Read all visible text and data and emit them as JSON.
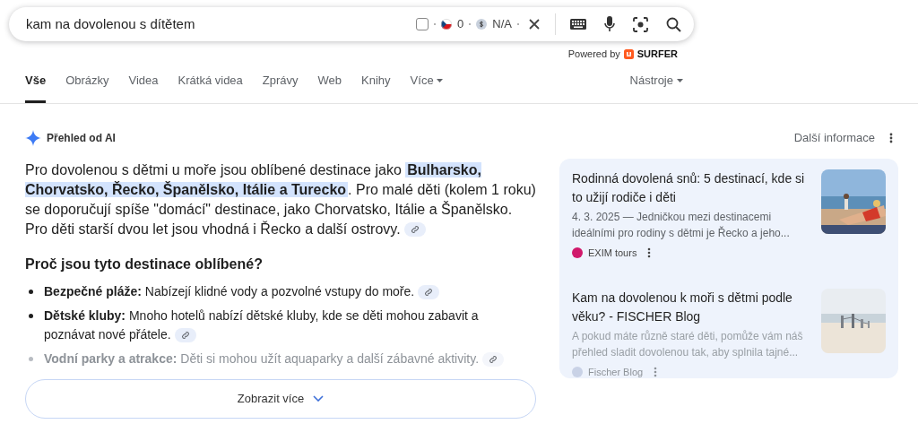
{
  "search": {
    "value": "kam na dovolenou s dítětem",
    "checked": false,
    "flag_count": "0",
    "price": "N/A",
    "powered_by": "Powered by",
    "brand": "SURFER"
  },
  "tabs": [
    {
      "label": "Vše",
      "selected": true,
      "dropdown": false
    },
    {
      "label": "Obrázky",
      "selected": false,
      "dropdown": false
    },
    {
      "label": "Videa",
      "selected": false,
      "dropdown": false
    },
    {
      "label": "Krátká videa",
      "selected": false,
      "dropdown": false
    },
    {
      "label": "Zprávy",
      "selected": false,
      "dropdown": false
    },
    {
      "label": "Web",
      "selected": false,
      "dropdown": false
    },
    {
      "label": "Knihy",
      "selected": false,
      "dropdown": false
    },
    {
      "label": "Více",
      "selected": false,
      "dropdown": true
    }
  ],
  "tools": "Nástroje",
  "ai_overview": {
    "title": "Přehled od AI",
    "more_info": "Další informace",
    "summary": "Pro dovolenou s dětmi u moře jsou oblíbené destinace jako **Bulharsko, Chorvatsko, Řecko, Španělsko, Itálie a Turecko**. Pro malé děti (kolem 1 roku) se doporučují spíše \"domácí\" destinace, jako Chorvatsko, Itálie a Španělsko. Pro děti starší dvou let jsou vhodná i Řecko a další ostrovy.",
    "heading": "Proč jsou tyto destinace oblíbené?",
    "bullets": [
      {
        "text": "**Bezpečné pláže:** Nabízejí klidné vody a pozvolné vstupy do moře.",
        "faded": false
      },
      {
        "text": "**Dětské kluby:** Mnoho hotelů nabízí dětské kluby, kde se děti mohou zabavit a poznávat nové přátele.",
        "faded": false
      },
      {
        "text": "**Vodní parky a atrakce:** Děti si mohou užít aquaparky a další zábavné aktivity.",
        "faded": true
      }
    ],
    "show_more": "Zobrazit více",
    "sources": [
      {
        "title": "Rodinná dovolená snů: 5 destinací, kde si to užijí rodiče i děti",
        "snippet": "4. 3. 2025 — Jedničkou mezi destinacemi ideálními pro rodiny s dětmi je Řecko a jeho...",
        "site": "EXIM tours",
        "faded": false,
        "color": "#d0186b"
      },
      {
        "title": "Kam na dovolenou k moři s dětmi podle věku? - FISCHER Blog",
        "snippet": "A pokud máte různě staré děti, pomůže vám náš přehled sladit dovolenou tak, aby splnila tajné...",
        "site": "Fischer Blog",
        "faded": true,
        "color": "#c9d2e6"
      }
    ]
  }
}
